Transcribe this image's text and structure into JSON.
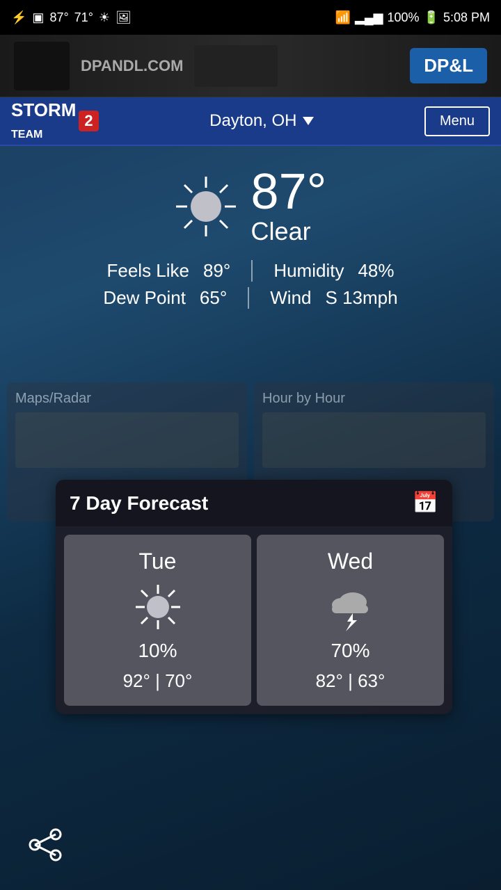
{
  "statusBar": {
    "leftIcons": [
      "usb-icon",
      "battery-100-icon",
      "temp-icon",
      "weather-icon",
      "image-icon"
    ],
    "temp": "87°",
    "feelsLike2": "71°",
    "rightIcons": [
      "wifi-icon",
      "signal-icon"
    ],
    "battery": "100%",
    "time": "5:08 PM"
  },
  "banner": {
    "websiteText": "DPANDL.COM",
    "logoText": "DP&L"
  },
  "header": {
    "appName": "STORM",
    "teamNumber": "2",
    "teamLabel": "TEAM",
    "location": "Dayton, OH",
    "menuLabel": "Menu"
  },
  "currentWeather": {
    "temperature": "87°",
    "condition": "Clear",
    "feelsLike": "89°",
    "humidity": "48%",
    "dewPoint": "65°",
    "wind": "S 13mph",
    "feelsLikeLabel": "Feels Like",
    "humidityLabel": "Humidity",
    "dewPointLabel": "Dew Point",
    "windLabel": "Wind"
  },
  "bgCards": [
    {
      "title": "Maps/Radar",
      "icon": "map-icon"
    },
    {
      "title": "Hour by Hour",
      "icon": "clock-icon"
    }
  ],
  "forecastWidget": {
    "title": "7 Day Forecast",
    "calendarIcon": "📅",
    "days": [
      {
        "name": "Tue",
        "iconType": "sun",
        "precipChance": "10%",
        "high": "92°",
        "low": "70°",
        "tempRange": "92° | 70°"
      },
      {
        "name": "Wed",
        "iconType": "storm",
        "precipChance": "70%",
        "high": "82°",
        "low": "63°",
        "tempRange": "82° | 63°"
      }
    ]
  },
  "shareButton": {
    "label": "share"
  }
}
